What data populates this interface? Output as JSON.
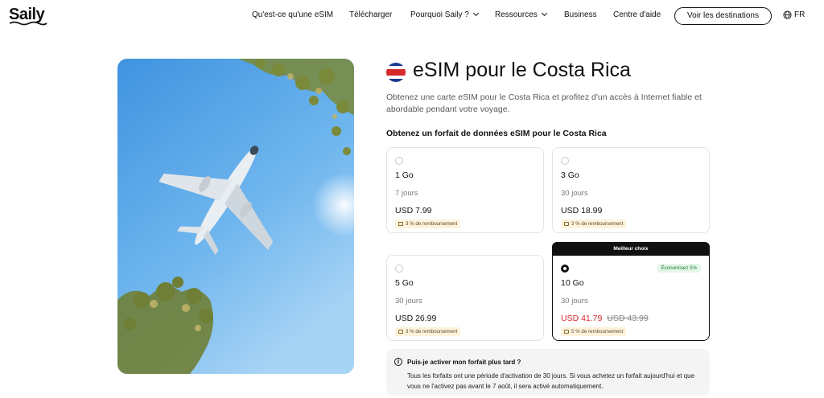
{
  "header": {
    "logo": "Saily",
    "nav": [
      {
        "label": "Qu'est-ce qu'une eSIM",
        "dropdown": false
      },
      {
        "label": "Télécharger",
        "dropdown": false
      },
      {
        "label": "Pourquoi Saily ?",
        "dropdown": true
      },
      {
        "label": "Ressources",
        "dropdown": true
      },
      {
        "label": "Business",
        "dropdown": false
      },
      {
        "label": "Centre d'aide",
        "dropdown": false
      }
    ],
    "cta_label": "Voir les destinations",
    "language": "FR",
    "language_icon": "globe-icon"
  },
  "main": {
    "flag_icon": "costa-rica-flag-icon",
    "title": "eSIM pour le Costa Rica",
    "subtitle": "Obtenez une carte eSIM pour le Costa Rica et profitez d'un accès à Internet fiable et abordable pendant votre voyage.",
    "plans_heading": "Obtenez un forfait de données eSIM pour le Costa Rica",
    "plans": [
      {
        "data": "1 Go",
        "duration": "7 jours",
        "price": "USD 7.99",
        "old_price": "",
        "cashback": "3 % de remboursement",
        "selected": false,
        "badge": "",
        "savings": ""
      },
      {
        "data": "3 Go",
        "duration": "30 jours",
        "price": "USD 18.99",
        "old_price": "",
        "cashback": "3 % de remboursement",
        "selected": false,
        "badge": "",
        "savings": ""
      },
      {
        "data": "5 Go",
        "duration": "30 jours",
        "price": "USD 26.99",
        "old_price": "",
        "cashback": "3 % de remboursement",
        "selected": false,
        "badge": "",
        "savings": ""
      },
      {
        "data": "10 Go",
        "duration": "30 jours",
        "price": "USD 41.79",
        "old_price": "USD 43.99",
        "cashback": "5 % de remboursement",
        "selected": true,
        "badge": "Meilleur choix",
        "savings": "Économisez 5%"
      }
    ],
    "info": {
      "question": "Puis-je activer mon forfait plus tard ?",
      "answer": "Tous les forfaits ont une période d'activation de 30 jours. Si vous achetez un forfait aujourd'hui et que vous ne l'activez pas avant le 7 août, il sera activé automatiquement."
    }
  },
  "colors": {
    "accent": "#111111",
    "sale_price": "#d9262c",
    "cashback_bg": "#fdf3dc",
    "savings_bg": "#e3f6e7",
    "savings_text": "#1e7b3b",
    "sky": "#5aa8e8"
  }
}
